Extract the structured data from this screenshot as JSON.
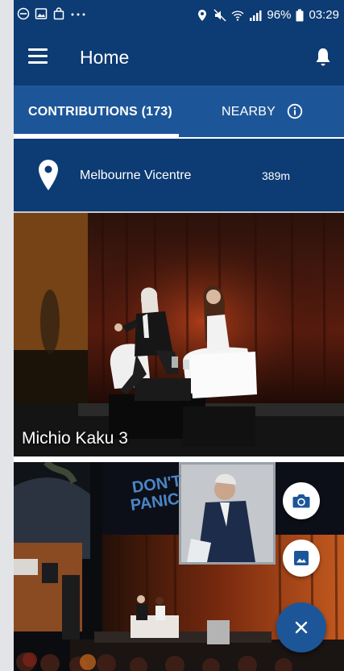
{
  "statusbar": {
    "battery": "96%",
    "time": "03:29"
  },
  "appbar": {
    "title": "Home"
  },
  "tabs": [
    {
      "label": "CONTRIBUTIONS (173)",
      "active": true
    },
    {
      "label": "NEARBY",
      "active": false
    }
  ],
  "location": {
    "name": "Melbourne Vicentre",
    "distance": "389m"
  },
  "photos": [
    {
      "caption": "Michio Kaku 3"
    },
    {
      "caption": ""
    }
  ],
  "stage_sign": "DON'T PANIC",
  "colors": {
    "primary": "#0d3b73",
    "tabs": "#1d5698",
    "fab": "#1d5698"
  },
  "icons": [
    "menu-icon",
    "bell-icon",
    "info-icon",
    "location-pin-icon",
    "camera-icon",
    "gallery-icon",
    "close-icon"
  ]
}
